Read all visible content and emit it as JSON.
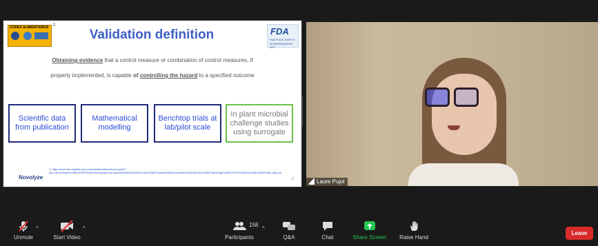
{
  "slide": {
    "number_top": "2",
    "title": "Validation definition",
    "codex_logo": {
      "caption": "CODEX ALIMENTARIUS"
    },
    "fda_logo": {
      "mark": "FDA",
      "line1": "FDA FOOD SAFETY",
      "line2": "MODERNIZATION ACT"
    },
    "body_line1": {
      "emph": "Obtaining evidence",
      "rest": " that a control measure or combination of control measures, if"
    },
    "body_line2": {
      "pre": "properly implemented, is capable ",
      "emph1": "of ",
      "emph2": "controlling the hazard",
      "post": " to a specified outcome"
    },
    "boxes": [
      {
        "label": "Scientific data from publication"
      },
      {
        "label": "Mathematical modelling"
      },
      {
        "label": "Benchtop trials at lab/pilot scale"
      },
      {
        "label": "In plant microbial challenge studies using surrogate"
      }
    ],
    "footer_brand": "Novolyze",
    "reference": "2. https://www.fao.org/fao-who-codexalimentarius/sh-proxy/ar/?lnk=1&url=https%253A%252F%252Fworkspace.fao.org%252Fsites%252Fcodex%252FShared%2BDocuments%252FArchive%252FMeetings%252FCCFH%252Fccfh38%252FfH38_08e.pdf",
    "number_bottom": "6"
  },
  "video": {
    "participant_name": "Laure Pujol"
  },
  "toolbar": {
    "unmute": "Unmute",
    "start_video": "Start Video",
    "participants": "Participants",
    "participants_count": "158",
    "qa": "Q&A",
    "chat": "Chat",
    "share_screen": "Share Screen",
    "raise_hand": "Raise Hand",
    "leave": "Leave"
  },
  "colors": {
    "title_blue": "#3d5fc4",
    "box_border": "#1e2a7a",
    "box_green": "#6ac146",
    "share_green": "#23c552",
    "leave_red": "#d92b2b"
  }
}
